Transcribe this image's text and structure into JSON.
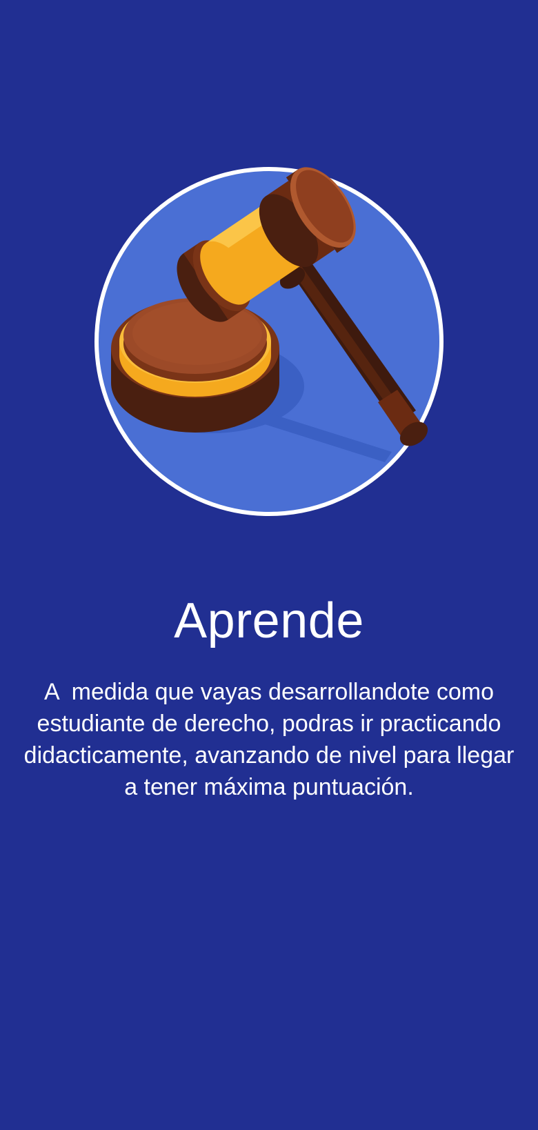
{
  "onboarding": {
    "title": "Aprende",
    "description": "A  medida que vayas desarrollandote como estudiante de derecho, podras ir practicando didacticamente, avanzando de nivel para llegar a tener máxima puntuación.",
    "illustration_icon": "gavel-icon"
  },
  "colors": {
    "background": "#212f92",
    "circle": "#4a6fd4",
    "circle_border": "#ffffff",
    "gold": "#f5a91e",
    "wood": "#9c4a28",
    "dark_wood": "#4a1f10"
  }
}
